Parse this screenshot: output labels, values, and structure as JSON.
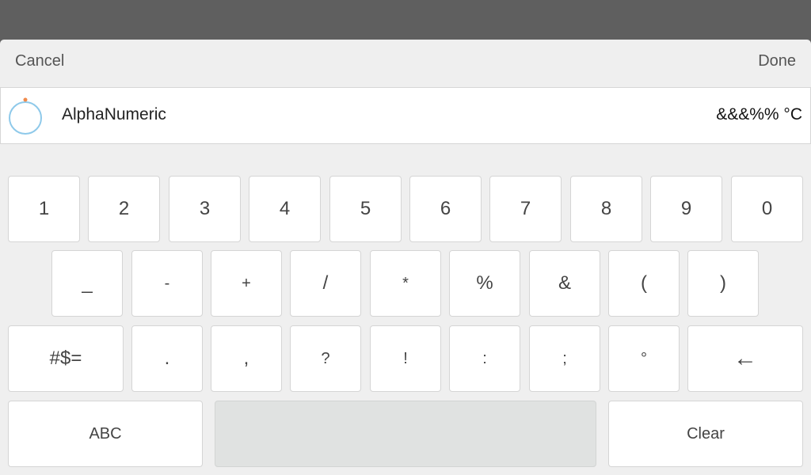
{
  "topbar": {
    "cancel_label": "Cancel",
    "done_label": "Done"
  },
  "field": {
    "label": "AlphaNumeric",
    "value": "&&&%% °C"
  },
  "keys": {
    "row1": [
      "1",
      "2",
      "3",
      "4",
      "5",
      "6",
      "7",
      "8",
      "9",
      "0"
    ],
    "row2": [
      "_",
      "-",
      "+",
      "/",
      "*",
      "%",
      "&",
      "(",
      ")"
    ],
    "row3": [
      "#$=",
      ".",
      ",",
      "?",
      "!",
      ":",
      ";",
      "°",
      "←"
    ],
    "row4": {
      "abc": "ABC",
      "space": "",
      "clear": "Clear"
    }
  },
  "colors": {
    "background": "#5f5f5f",
    "panel": "#efefef",
    "key": "#ffffff",
    "space_key": "#e0e2e1",
    "icon_ring": "#8ec9ea",
    "icon_dot": "#f08a4b"
  }
}
